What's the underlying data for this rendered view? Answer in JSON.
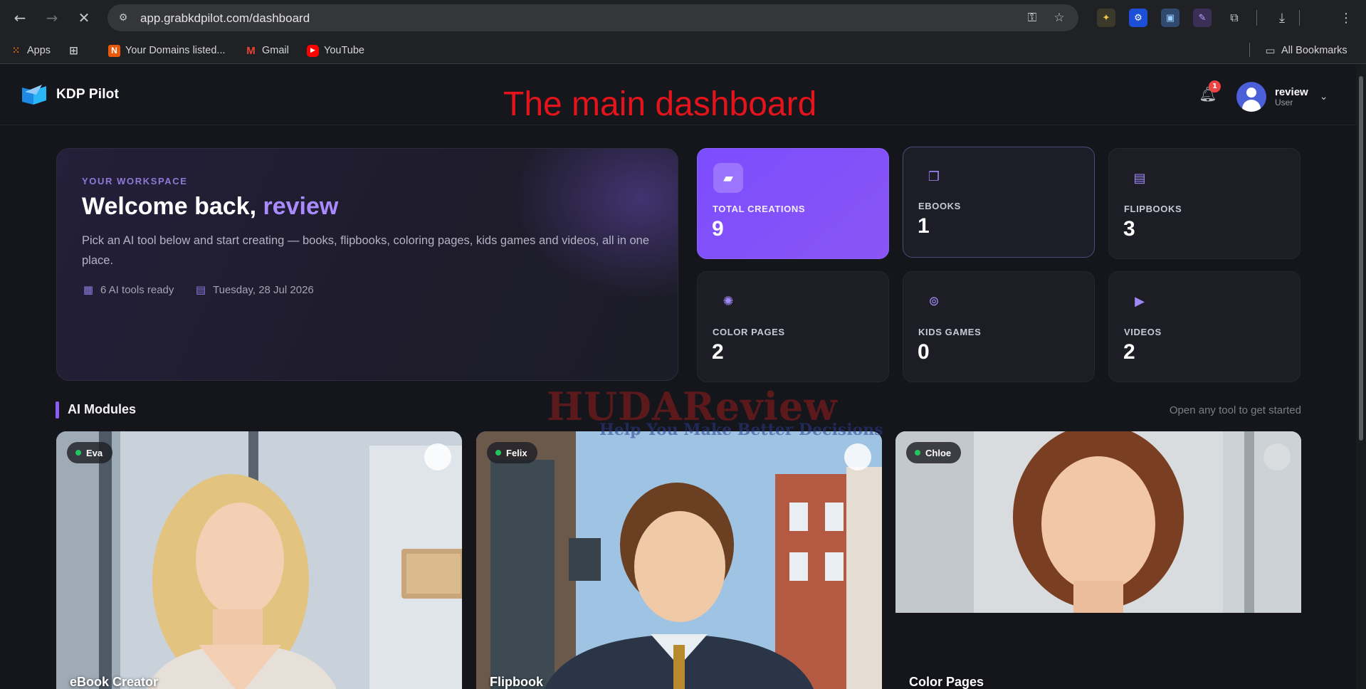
{
  "browser": {
    "url": "app.grabkdpilot.com/dashboard",
    "bookmarks": [
      {
        "label": "Apps",
        "icon": "apps-grid-icon"
      },
      {
        "label": "",
        "icon": "tab-groups-icon"
      },
      {
        "label": "Your Domains listed...",
        "icon": "domains-icon"
      },
      {
        "label": "Gmail",
        "icon": "gmail-icon"
      },
      {
        "label": "YouTube",
        "icon": "youtube-icon"
      }
    ],
    "all_bookmarks": "All Bookmarks"
  },
  "header": {
    "brand": "KDP Pilot",
    "caption": "The main dashboard",
    "notifications_count": "1",
    "user_name": "review",
    "user_role": "User"
  },
  "welcome": {
    "kicker": "YOUR WORKSPACE",
    "greeting": "Welcome back,",
    "name": "review",
    "description": "Pick an AI tool below and start creating — books, flipbooks, coloring pages, kids games and videos, all in one place.",
    "tools_ready": "6 AI tools ready",
    "date": "Tuesday, 28 Jul 2026"
  },
  "stats": [
    {
      "label": "TOTAL CREATIONS",
      "value": "9",
      "icon": "briefcase-icon"
    },
    {
      "label": "EBOOKS",
      "value": "1",
      "icon": "ebook-icon"
    },
    {
      "label": "FLIPBOOKS",
      "value": "3",
      "icon": "flipbook-icon"
    },
    {
      "label": "COLOR PAGES",
      "value": "2",
      "icon": "palette-icon"
    },
    {
      "label": "KIDS GAMES",
      "value": "0",
      "icon": "gamepad-icon"
    },
    {
      "label": "VIDEOS",
      "value": "2",
      "icon": "video-icon"
    }
  ],
  "modules_section": {
    "title": "AI Modules",
    "hint": "Open any tool to get started"
  },
  "modules": [
    {
      "assistant": "Eva",
      "name": "eBook Creator"
    },
    {
      "assistant": "Felix",
      "name": "Flipbook"
    },
    {
      "assistant": "Chloe",
      "name": "Color Pages"
    }
  ],
  "watermark": {
    "title": "HUDAReview",
    "tagline": "Help You Make Better Decisions"
  },
  "colors": {
    "accent": "#8b5cf6",
    "caption_red": "#e3141b",
    "status_online": "#22c55e"
  }
}
